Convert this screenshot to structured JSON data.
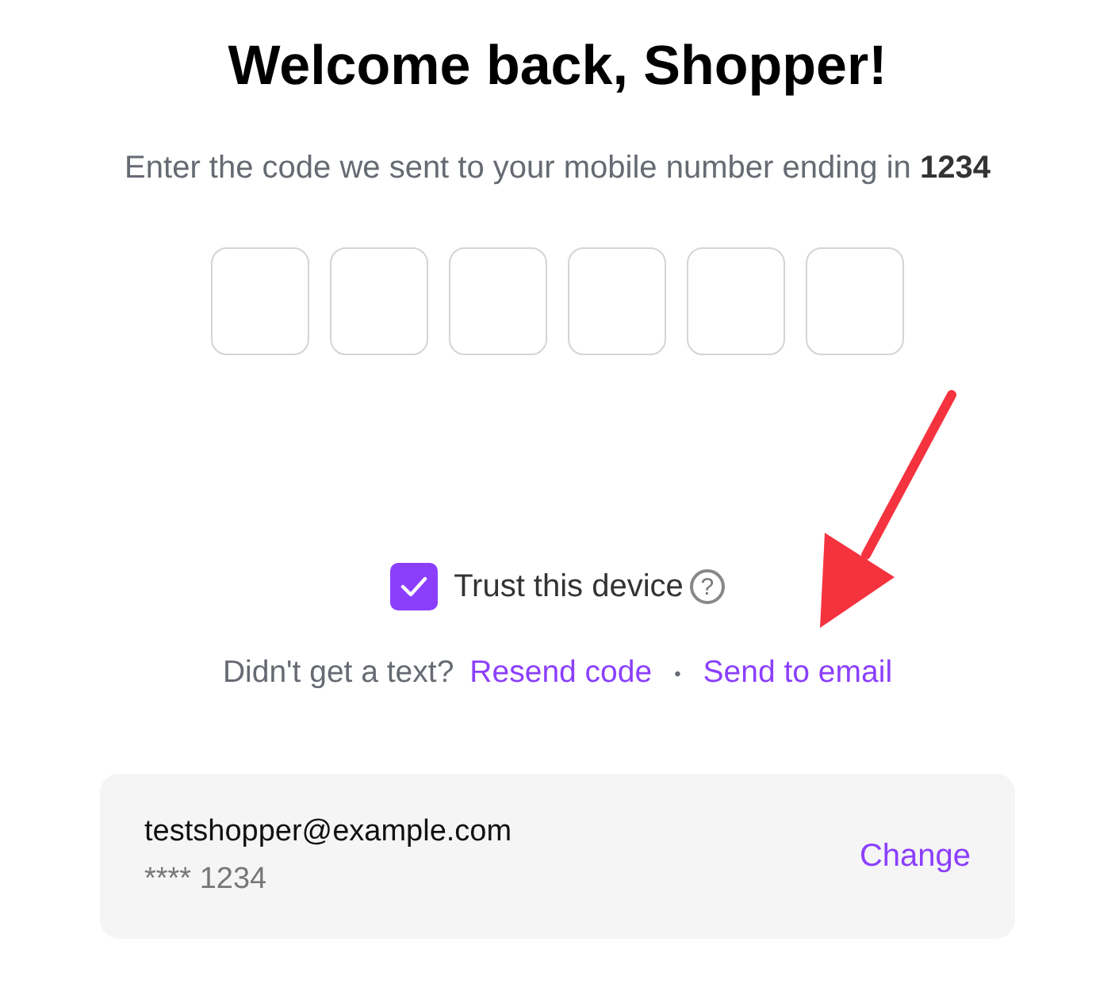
{
  "title": "Welcome back, Shopper!",
  "subtitle": "Enter the code we sent to your mobile number ending in **1234**",
  "code_fields": [
    {
      "filled": false
    },
    {
      "filled": false
    },
    {
      "filled": false
    },
    {
      "filled": false
    },
    {
      "filled": false
    },
    {
      "filled": false
    }
  ],
  "trust_device": {
    "label": "Trust this device",
    "checked": true,
    "help": "?"
  },
  "resend": {
    "prompt": "Didn't get a text?",
    "links": [
      "Resend code",
      "Send to email"
    ],
    "separator": "•"
  },
  "account": {
    "email": "testshopper@example.com",
    "phone": "**** 1234",
    "action": "Change"
  }
}
